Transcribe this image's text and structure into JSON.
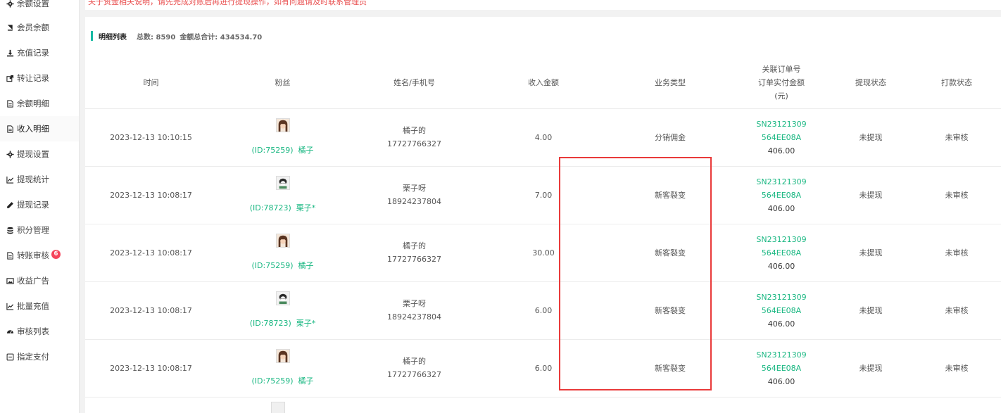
{
  "topbar": {
    "notice": "关于资金相关说明，请先完成对账后再进行提现操作，如有问题请及时联系管理员"
  },
  "sidebar": {
    "items": [
      {
        "label": "余额设置",
        "icon": "gear-icon"
      },
      {
        "label": "会员余额",
        "icon": "book-icon"
      },
      {
        "label": "充值记录",
        "icon": "download-icon"
      },
      {
        "label": "转让记录",
        "icon": "external-link-icon"
      },
      {
        "label": "余额明细",
        "icon": "file-text-icon"
      },
      {
        "label": "收入明细",
        "icon": "file-text-icon"
      },
      {
        "label": "提现设置",
        "icon": "gear-icon"
      },
      {
        "label": "提现统计",
        "icon": "line-chart-icon"
      },
      {
        "label": "提现记录",
        "icon": "pencil-icon"
      },
      {
        "label": "积分管理",
        "icon": "database-icon"
      },
      {
        "label": "转账审核",
        "icon": "file-text-icon",
        "badge": "6"
      },
      {
        "label": "收益广告",
        "icon": "image-icon"
      },
      {
        "label": "批量充值",
        "icon": "line-chart-icon"
      },
      {
        "label": "审核列表",
        "icon": "dashboard-icon"
      },
      {
        "label": "指定支付",
        "icon": "minus-square-icon"
      }
    ]
  },
  "summary": {
    "title": "明细列表",
    "total_label": "总数: 8590",
    "amount_label": "金额总合计: 434534.70"
  },
  "table": {
    "headers": {
      "time": "时间",
      "fan": "粉丝",
      "name_phone": "姓名/手机号",
      "income": "收入金额",
      "biz_type": "业务类型",
      "order_line1": "关联订单号",
      "order_line2": "订单实付金额",
      "order_line3": "(元)",
      "withdraw_status": "提现状态",
      "pay_status": "打款状态"
    },
    "rows": [
      {
        "time": "2023-12-13 10:10:15",
        "fan_id": "(ID:75259)",
        "fan_name": "橘子",
        "name": "橘子的",
        "phone": "17727766327",
        "income": "4.00",
        "biz_type": "分销佣金",
        "order_a": "SN23121309",
        "order_b": "564EE08A",
        "order_amount": "406.00",
        "withdraw_status": "未提现",
        "pay_status": "未审核"
      },
      {
        "time": "2023-12-13 10:08:17",
        "fan_id": "(ID:78723)",
        "fan_name": "栗子*",
        "name": "栗子呀",
        "phone": "18924237804",
        "income": "7.00",
        "biz_type": "新客裂变",
        "order_a": "SN23121309",
        "order_b": "564EE08A",
        "order_amount": "406.00",
        "withdraw_status": "未提现",
        "pay_status": "未审核"
      },
      {
        "time": "2023-12-13 10:08:17",
        "fan_id": "(ID:75259)",
        "fan_name": "橘子",
        "name": "橘子的",
        "phone": "17727766327",
        "income": "30.00",
        "biz_type": "新客裂变",
        "order_a": "SN23121309",
        "order_b": "564EE08A",
        "order_amount": "406.00",
        "withdraw_status": "未提现",
        "pay_status": "未审核"
      },
      {
        "time": "2023-12-13 10:08:17",
        "fan_id": "(ID:78723)",
        "fan_name": "栗子*",
        "name": "栗子呀",
        "phone": "18924237804",
        "income": "6.00",
        "biz_type": "新客裂变",
        "order_a": "SN23121309",
        "order_b": "564EE08A",
        "order_amount": "406.00",
        "withdraw_status": "未提现",
        "pay_status": "未审核"
      },
      {
        "time": "2023-12-13 10:08:17",
        "fan_id": "(ID:75259)",
        "fan_name": "橘子",
        "name": "橘子的",
        "phone": "17727766327",
        "income": "6.00",
        "biz_type": "新客裂变",
        "order_a": "SN23121309",
        "order_b": "564EE08A",
        "order_amount": "406.00",
        "withdraw_status": "未提现",
        "pay_status": "未审核"
      }
    ]
  },
  "colors": {
    "accent": "#16b9a3",
    "link_green": "#18b781",
    "badge_red": "#f5455c",
    "annotation_red": "#e93a3a"
  }
}
